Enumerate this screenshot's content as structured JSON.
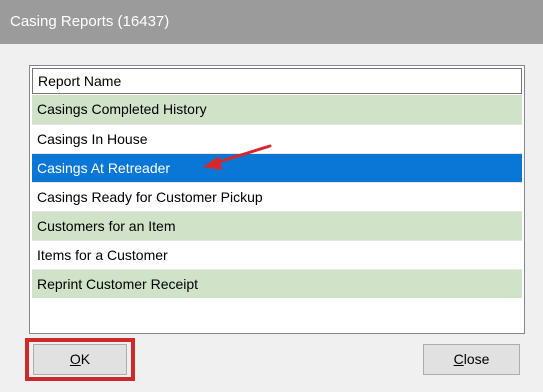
{
  "window": {
    "title": "Casing Reports (16437)"
  },
  "list": {
    "header": "Report Name",
    "rows": [
      {
        "label": "Casings Completed History",
        "state": "green"
      },
      {
        "label": "Casings In House",
        "state": "white"
      },
      {
        "label": "Casings At Retreader",
        "state": "selected"
      },
      {
        "label": "Casings Ready for Customer Pickup",
        "state": "white"
      },
      {
        "label": "Customers for an Item",
        "state": "green"
      },
      {
        "label": "Items for a Customer",
        "state": "white"
      },
      {
        "label": "Reprint Customer Receipt",
        "state": "green"
      }
    ]
  },
  "buttons": {
    "ok": {
      "mnemonic": "O",
      "rest": "K"
    },
    "close": {
      "mnemonic": "C",
      "rest": "lose"
    }
  },
  "colors": {
    "titlebar": "#9b9b9b",
    "row_green": "#d0e3c9",
    "row_selected": "#0a77d6",
    "highlight_red": "#cc2a2a"
  },
  "icons": {
    "pointer": "red-arrow-icon"
  }
}
